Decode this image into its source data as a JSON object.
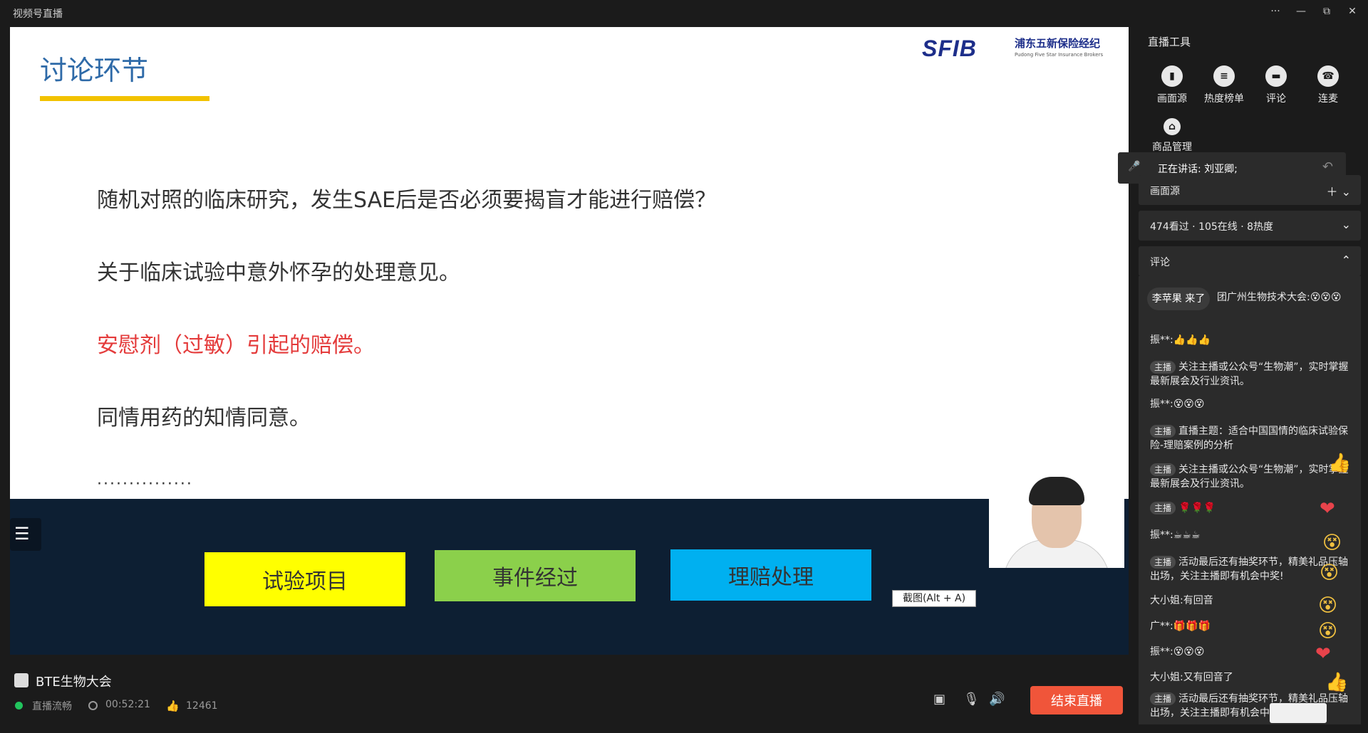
{
  "app": {
    "title": "视频号直播"
  },
  "window_controls": [
    "···",
    "—",
    "⧉",
    "✕"
  ],
  "slide": {
    "title": "讨论环节",
    "logo_mark": "SFIB",
    "logo_cn": "浦东五新保险经纪",
    "logo_en": "Pudong Five Star Insurance Brokers",
    "questions": [
      "随机对照的临床研究，发生SAE后是否必须要揭盲才能进行赔偿？",
      "关于临床试验中意外怀孕的处理意见。",
      "安慰剂（过敏）引起的赔偿。",
      "同情用药的知情同意。"
    ],
    "dots": "···············",
    "boxes": [
      "试验项目",
      "事件经过",
      "理赔处理"
    ],
    "screenshot_tip": "截图(Alt + A)",
    "menu_icon": "☰"
  },
  "footer": {
    "room_name": "BTE生物大会",
    "status": "直播流畅",
    "duration": "00:52:21",
    "likes": "12461",
    "end_label": "结束直播"
  },
  "panel": {
    "title": "直播工具",
    "tools": [
      {
        "label": "画面源",
        "icon": "screen-source-icon"
      },
      {
        "label": "热度榜单",
        "icon": "list-icon"
      },
      {
        "label": "评论",
        "icon": "comment-icon"
      },
      {
        "label": "连麦",
        "icon": "phone-icon"
      },
      {
        "label": "商品管理",
        "icon": "bag-icon"
      }
    ],
    "speaking": "正在讲话: 刘亚卿;",
    "source_section": "画面源",
    "stats": "474看过 · 105在线 · 8热度",
    "comment_section": "评论",
    "joined": "李苹果 来了",
    "comments": [
      {
        "tag": "",
        "text": "团广州生物技术大会:😵😵😵"
      },
      {
        "tag": "",
        "text": "振**:👍👍👍"
      },
      {
        "tag": "主播",
        "text": "关注主播或公众号“生物潮”，实时掌握最新展会及行业资讯。"
      },
      {
        "tag": "",
        "text": "振**:😵😵😵"
      },
      {
        "tag": "主播",
        "text": "直播主题：适合中国国情的临床试验保险-理赔案例的分析"
      },
      {
        "tag": "主播",
        "text": "关注主播或公众号“生物潮”，实时掌握最新展会及行业资讯。"
      },
      {
        "tag": "主播",
        "text": "🌹🌹🌹"
      },
      {
        "tag": "",
        "text": "振**:☕☕☕"
      },
      {
        "tag": "主播",
        "text": "活动最后还有抽奖环节，精美礼品压轴出场，关注主播即有机会中奖!"
      },
      {
        "tag": "",
        "text": "大小姐:有回音"
      },
      {
        "tag": "",
        "text": "广**:🎁🎁🎁"
      },
      {
        "tag": "",
        "text": "振**:😵😵😵"
      },
      {
        "tag": "",
        "text": "大小姐:又有回音了"
      },
      {
        "tag": "主播",
        "text": "活动最后还有抽奖环节，精美礼品压轴出场，关注主播即有机会中奖!"
      }
    ]
  }
}
